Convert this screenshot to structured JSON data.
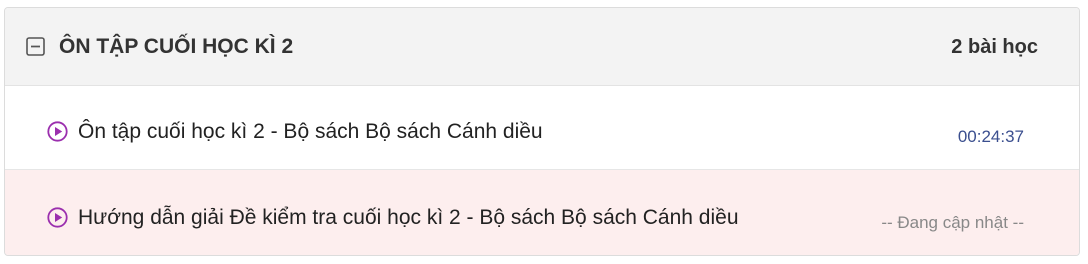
{
  "section": {
    "title": "ÔN TẬP CUỐI HỌC KÌ 2",
    "lesson_count": "2 bài học",
    "expanded": true,
    "collapse_icon": "minus-square-icon"
  },
  "lessons": [
    {
      "title": "Ôn tập cuối học kì 2 - Bộ sách Bộ sách Cánh diều",
      "meta": "00:24:37",
      "icon": "play-circle-icon"
    },
    {
      "title": "Hướng dẫn giải Đề kiểm tra cuối học kì 2 - Bộ sách Bộ sách Cánh diều",
      "meta": "-- Đang cập nhật --",
      "icon": "play-circle-icon"
    }
  ],
  "colors": {
    "header_bg": "#f3f3f3",
    "play_icon": "#9b2fae",
    "duration_text": "#3b4f8f",
    "status_text": "#888888",
    "highlight_row_bg": "#fdeeee"
  }
}
